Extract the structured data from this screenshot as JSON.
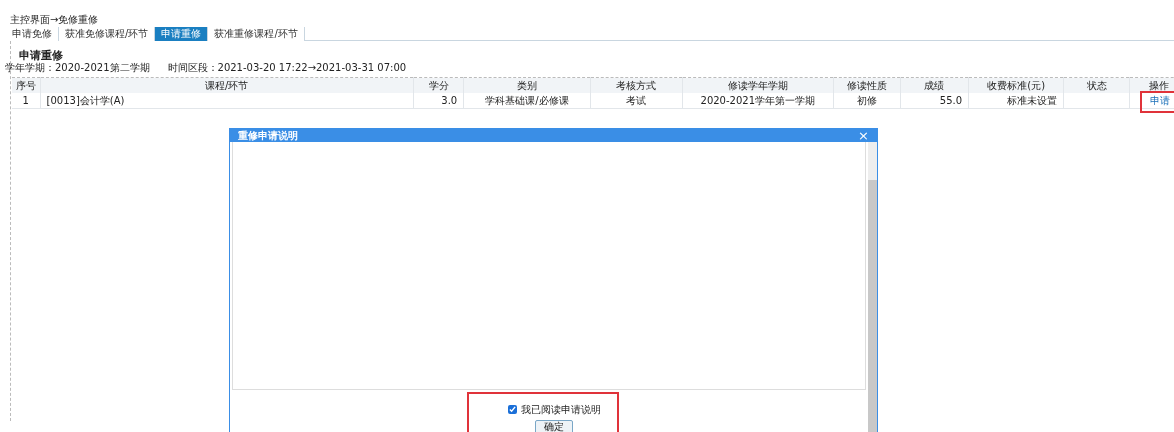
{
  "breadcrumb": "主控界面→免修重修",
  "tabs": [
    {
      "label": "申请免修",
      "selected": false
    },
    {
      "label": "获准免修课程/环节",
      "selected": false
    },
    {
      "label": "申请重修",
      "selected": true
    },
    {
      "label": "获准重修课程/环节",
      "selected": false
    }
  ],
  "section_title": "申请重修",
  "term": {
    "label": "学年学期：",
    "value": "2020-2021第二学期"
  },
  "range": {
    "label": "时间区段：",
    "value": "2021-03-20 17:22→2021-03-31 07:00"
  },
  "table": {
    "columns": [
      "序号",
      "课程/环节",
      "学分",
      "类别",
      "考核方式",
      "修读学年学期",
      "修读性质",
      "成绩",
      "收费标准(元)",
      "状态",
      "操作"
    ],
    "rows": [
      {
        "cells": [
          "1",
          "[0013]会计学(A)",
          "3.0",
          "学科基础课/必修课",
          "考试",
          "2020-2021学年第一学期",
          "初修",
          "55.0",
          "标准未设置",
          ""
        ],
        "action": {
          "label": "申请",
          "highlighted": true
        }
      }
    ]
  },
  "dialog": {
    "title": "重修申请说明",
    "close": "×",
    "checkbox": {
      "label": "我已阅读申请说明",
      "checked": true
    },
    "confirm": "确定",
    "footer_highlighted": true
  }
}
